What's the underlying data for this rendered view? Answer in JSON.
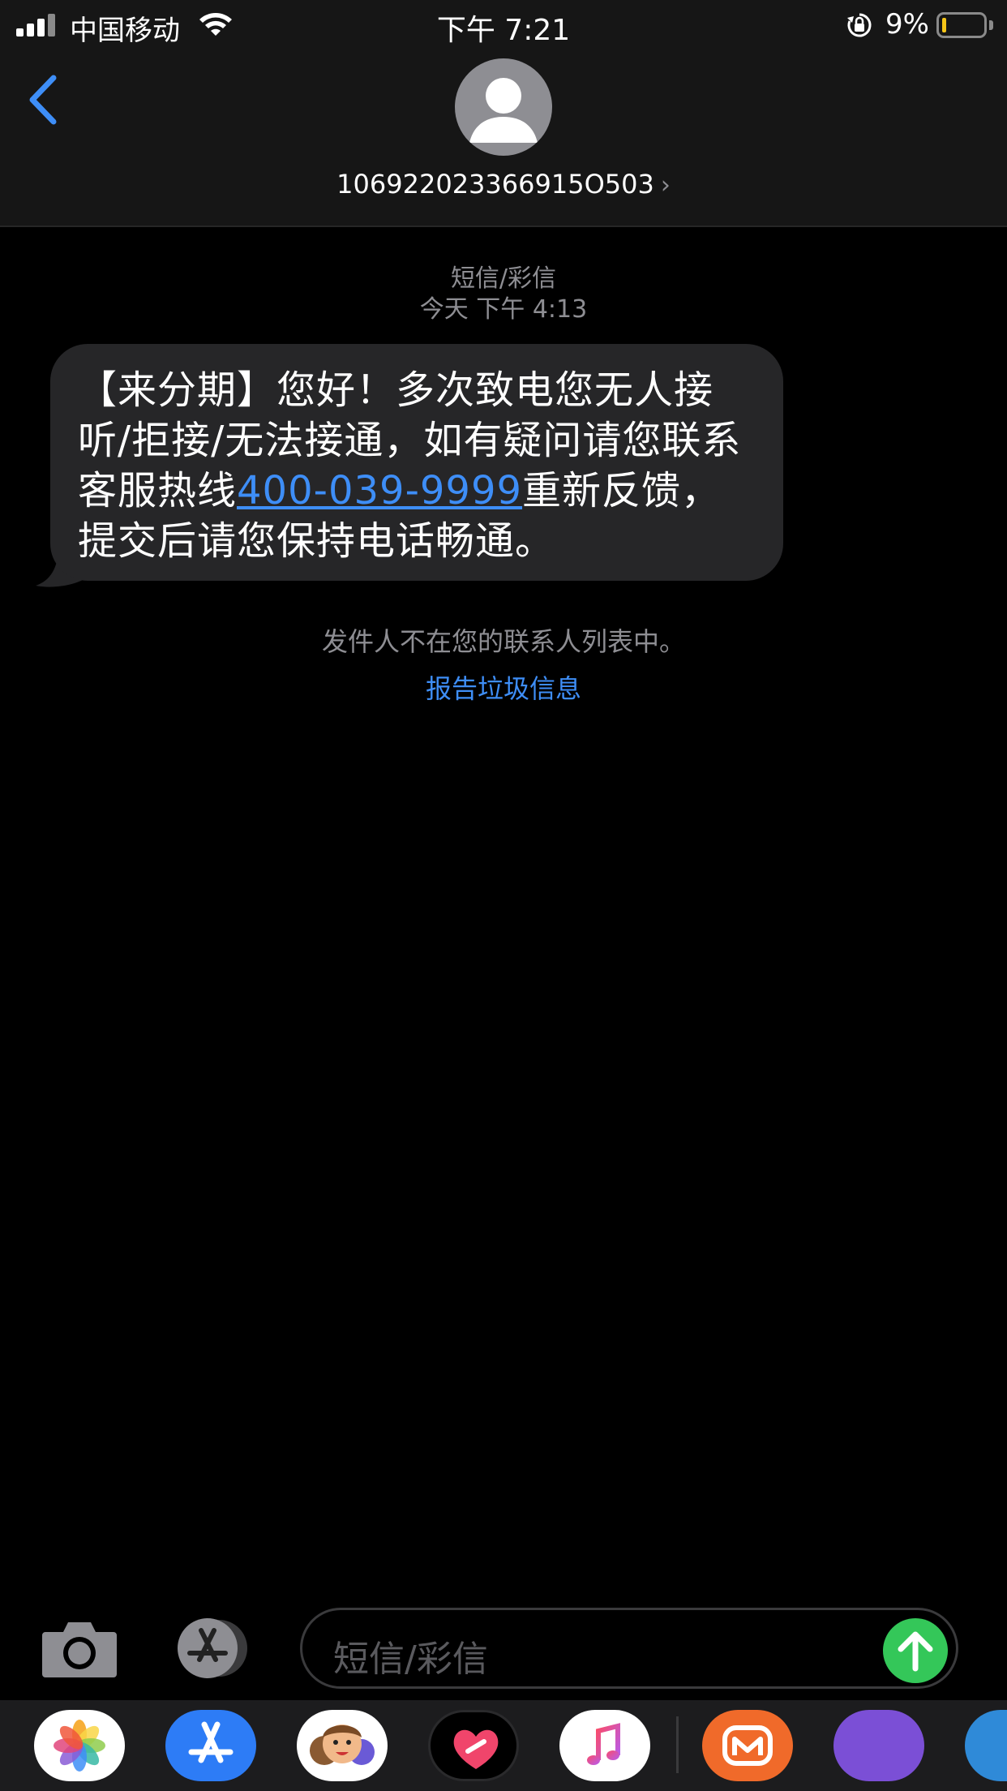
{
  "status_bar": {
    "carrier": "中国移动",
    "time": "下午 7:21",
    "battery_percent": "9%",
    "battery_level": 0.09,
    "battery_color": "#f5c518"
  },
  "header": {
    "back_icon": "chevron-left-icon",
    "avatar_icon": "person-icon",
    "contact_number": "106922023366915O503",
    "contact_chevron": "›"
  },
  "conversation": {
    "service_label": "短信/彩信",
    "timestamp": "今天 下午 4:13",
    "message": {
      "part1": "【来分期】您好！多次致电您无人接听/拒接/无法接通，如有疑问请您联系客服热线",
      "link": "400-039-9999",
      "part2": "重新反馈，提交后请您保持电话畅通。"
    },
    "notice": "发件人不在您的联系人列表中。",
    "report_link": "报告垃圾信息"
  },
  "input_bar": {
    "camera_icon": "camera-icon",
    "apps_icon": "app-store-icon",
    "placeholder": "短信/彩信",
    "send_icon": "arrow-up-icon",
    "send_color": "#34c759"
  },
  "app_drawer": {
    "apps": [
      "photos-icon",
      "app-store-icon",
      "memoji-icon",
      "digital-touch-icon",
      "music-icon",
      "mango-tv-icon",
      "app-icon",
      "app-icon"
    ]
  },
  "colors": {
    "accent": "#3e8ef7",
    "bubble": "#262628",
    "header_bg": "#161616"
  }
}
